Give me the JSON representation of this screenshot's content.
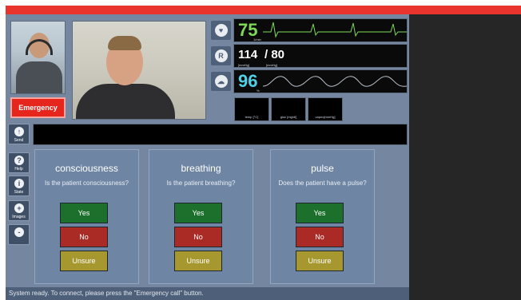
{
  "emergency_label": "Emergency",
  "vitals": {
    "heart_rate": {
      "value": "75",
      "unit": "1/min",
      "color": "#7ed957"
    },
    "blood_pressure": {
      "systolic": "114",
      "diastolic": "/ 80",
      "unit1": "[mmHg]",
      "unit2": "[mmHg]"
    },
    "spo2": {
      "value": "96",
      "unit": "%",
      "color": "#4fd1e6"
    },
    "small_labels": [
      "temp [°C]",
      "gluc [mg/dl]",
      "capno[mmHg]"
    ]
  },
  "send_label": "Send",
  "sidebar": [
    {
      "label": "Help",
      "icon": "?"
    },
    {
      "label": "State",
      "icon": "i"
    },
    {
      "label": "Images",
      "icon": "+"
    },
    {
      "label": "",
      "icon": "-"
    }
  ],
  "panels": [
    {
      "title": "consciousness",
      "question": "Is the patient consciousness?",
      "yes": "Yes",
      "no": "No",
      "unsure": "Unsure"
    },
    {
      "title": "breathing",
      "question": "Is the patient breathing?",
      "yes": "Yes",
      "no": "No",
      "unsure": "Unsure"
    },
    {
      "title": "pulse",
      "question": "Does the patient have a pulse?",
      "yes": "Yes",
      "no": "No",
      "unsure": "Unsure"
    }
  ],
  "status_text": "System ready. To connect, please press the \"Emergency call\" button."
}
